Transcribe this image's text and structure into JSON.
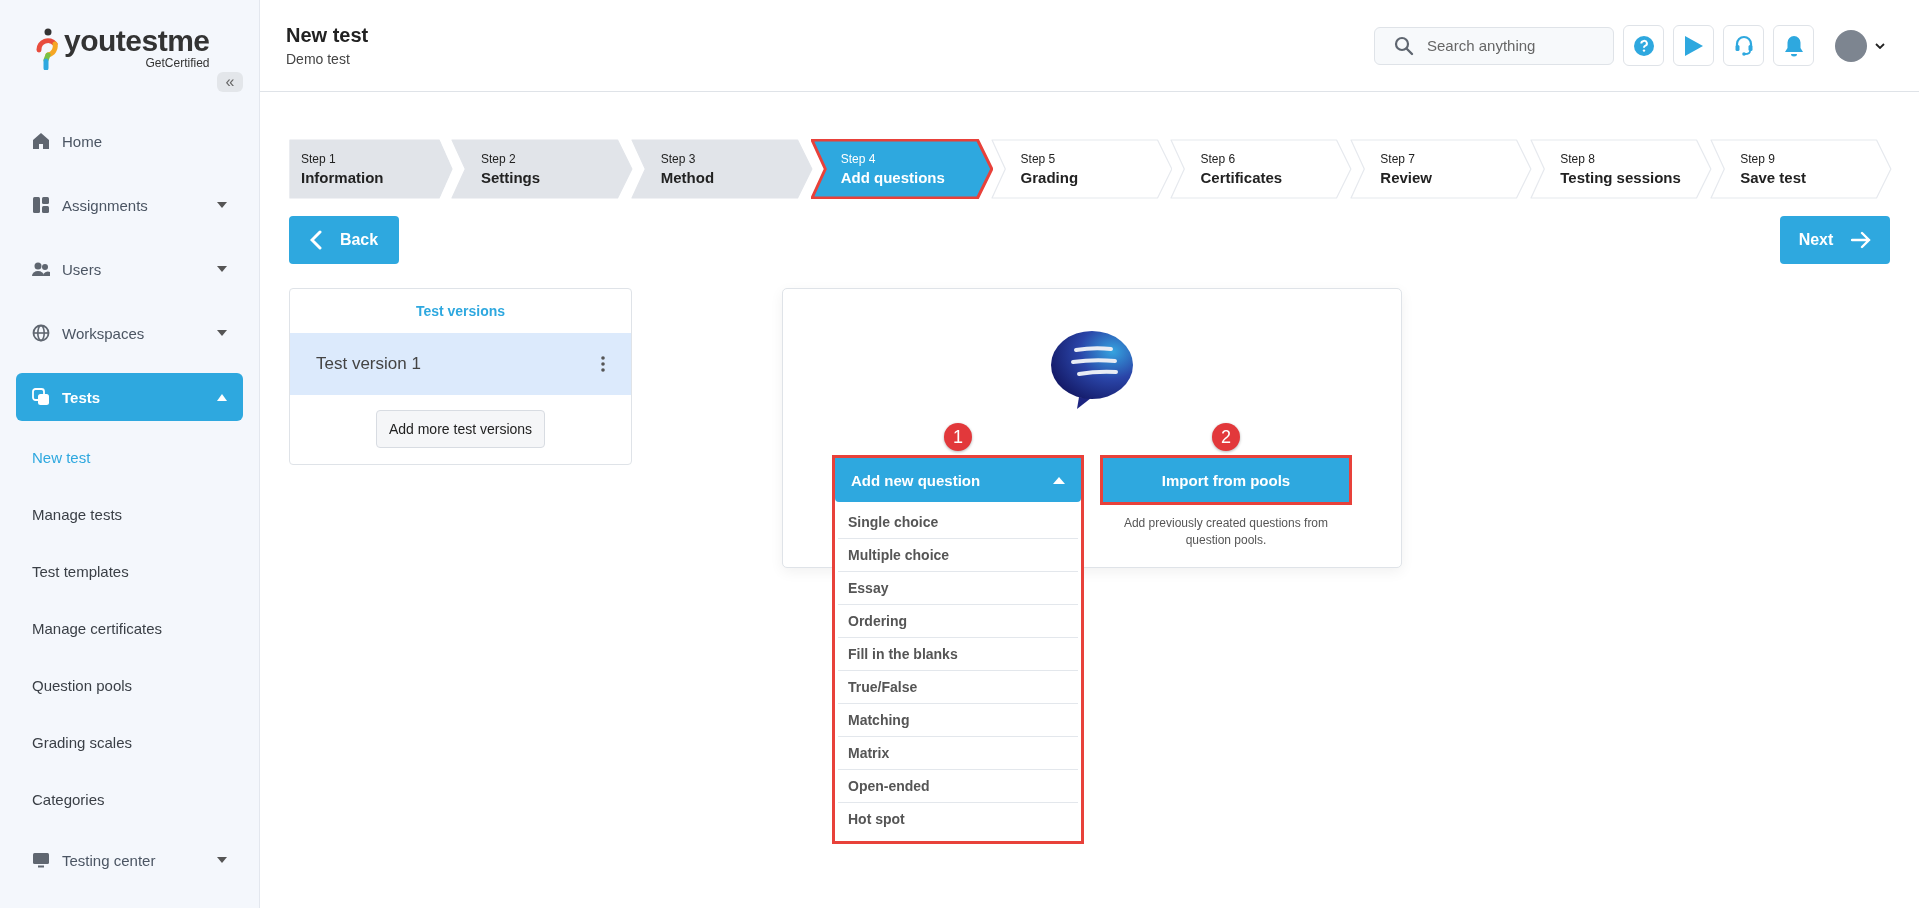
{
  "logo": {
    "brand": "youtestme",
    "tagline": "GetCertified"
  },
  "sidebar": {
    "collapse_label": "«",
    "items": [
      {
        "label": "Home",
        "selected": false
      },
      {
        "label": "Assignments",
        "selected": false,
        "expanded": false
      },
      {
        "label": "Users",
        "selected": false,
        "expanded": false
      },
      {
        "label": "Workspaces",
        "selected": false,
        "expanded": false
      },
      {
        "label": "Tests",
        "selected": true,
        "expanded": true,
        "children": [
          {
            "label": "New test",
            "selected": true
          },
          {
            "label": "Manage tests",
            "selected": false
          },
          {
            "label": "Test templates",
            "selected": false
          },
          {
            "label": "Manage certificates",
            "selected": false
          },
          {
            "label": "Question pools",
            "selected": false
          },
          {
            "label": "Grading scales",
            "selected": false
          },
          {
            "label": "Categories",
            "selected": false
          }
        ]
      },
      {
        "label": "Testing center",
        "selected": false,
        "expanded": false
      }
    ]
  },
  "header": {
    "title": "New test",
    "subtitle": "Demo test",
    "search": {
      "placeholder": "Search anything"
    }
  },
  "steps": [
    {
      "step": "Step 1",
      "label": "Information",
      "kind": "done",
      "highlighted": false
    },
    {
      "step": "Step 2",
      "label": "Settings",
      "kind": "done",
      "highlighted": false
    },
    {
      "step": "Step 3",
      "label": "Method",
      "kind": "done",
      "highlighted": false
    },
    {
      "step": "Step 4",
      "label": "Add questions",
      "kind": "current",
      "highlighted": true
    },
    {
      "step": "Step 5",
      "label": "Grading",
      "kind": "upcoming",
      "highlighted": false
    },
    {
      "step": "Step 6",
      "label": "Certificates",
      "kind": "upcoming",
      "highlighted": false
    },
    {
      "step": "Step 7",
      "label": "Review",
      "kind": "upcoming",
      "highlighted": false
    },
    {
      "step": "Step 8",
      "label": "Testing sessions",
      "kind": "upcoming",
      "highlighted": false
    },
    {
      "step": "Step 9",
      "label": "Save test",
      "kind": "upcoming",
      "highlighted": false
    }
  ],
  "back_button": "Back",
  "next_button": "Next",
  "test_versions": {
    "title": "Test versions",
    "versions": [
      {
        "name": "Test version 1",
        "selected": true
      }
    ],
    "add_button": "Add more test versions"
  },
  "add_question": {
    "badge": "1",
    "label": "Add new question",
    "expanded": true,
    "highlighted": true,
    "options": [
      "Single choice",
      "Multiple choice",
      "Essay",
      "Ordering",
      "Fill in the blanks",
      "True/False",
      "Matching",
      "Matrix",
      "Open-ended",
      "Hot spot"
    ]
  },
  "import": {
    "badge": "2",
    "label": "Import from pools",
    "highlighted": true,
    "description": "Add previously created questions from question pools."
  }
}
